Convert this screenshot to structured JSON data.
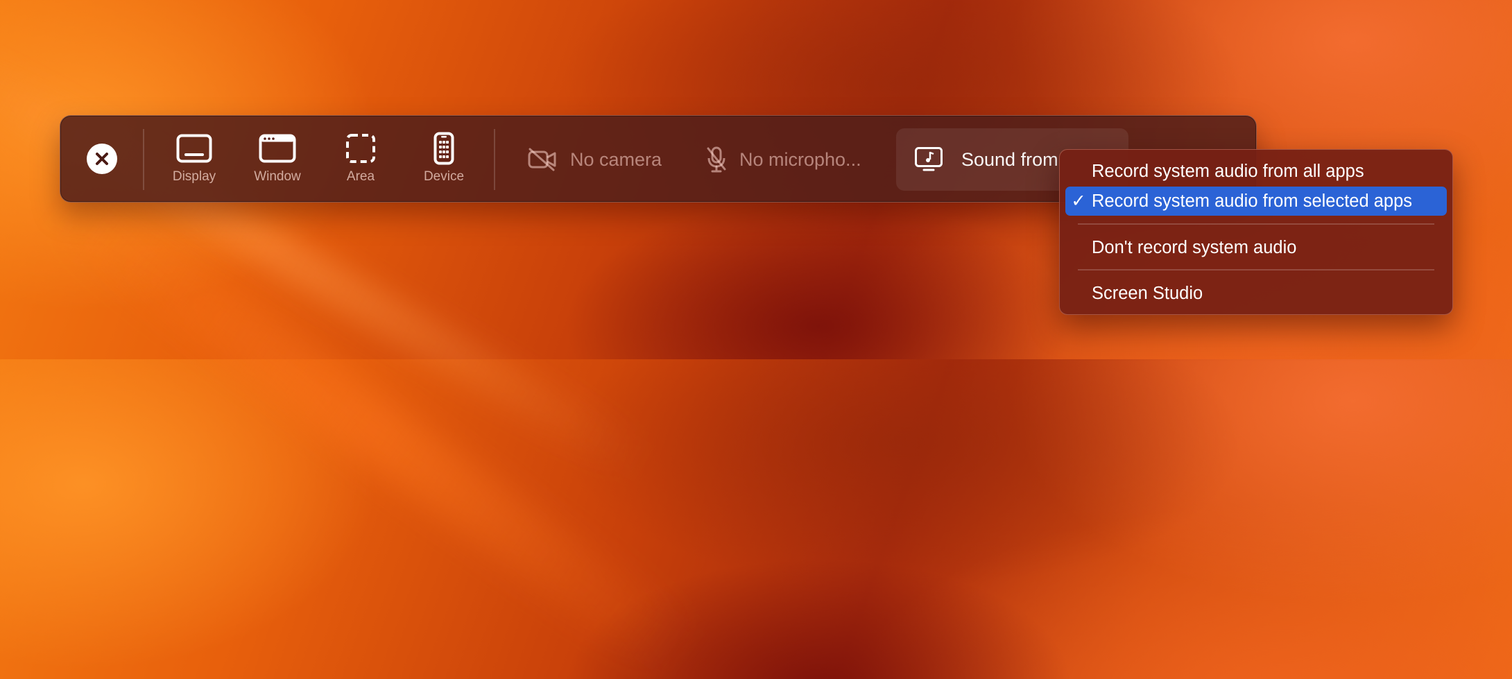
{
  "toolbar": {
    "capture_modes": [
      {
        "label": "Display",
        "icon": "display-icon"
      },
      {
        "label": "Window",
        "icon": "window-icon"
      },
      {
        "label": "Area",
        "icon": "area-selection-icon"
      },
      {
        "label": "Device",
        "icon": "phone-device-icon"
      }
    ],
    "camera_label": "No camera",
    "microphone_label": "No micropho...",
    "sound_label": "Sound from"
  },
  "sound_menu": {
    "items": [
      {
        "label": "Record system audio from all apps",
        "checked": false
      },
      {
        "label": "Record system audio from selected apps",
        "checked": true
      },
      {
        "label": "Don't record system audio",
        "checked": false
      },
      {
        "label": "Screen Studio",
        "checked": false
      }
    ],
    "check_glyph": "✓"
  },
  "colors": {
    "selection": "#2b63d6",
    "toolbar_bg": "#50201a",
    "menu_bg": "#762014"
  }
}
